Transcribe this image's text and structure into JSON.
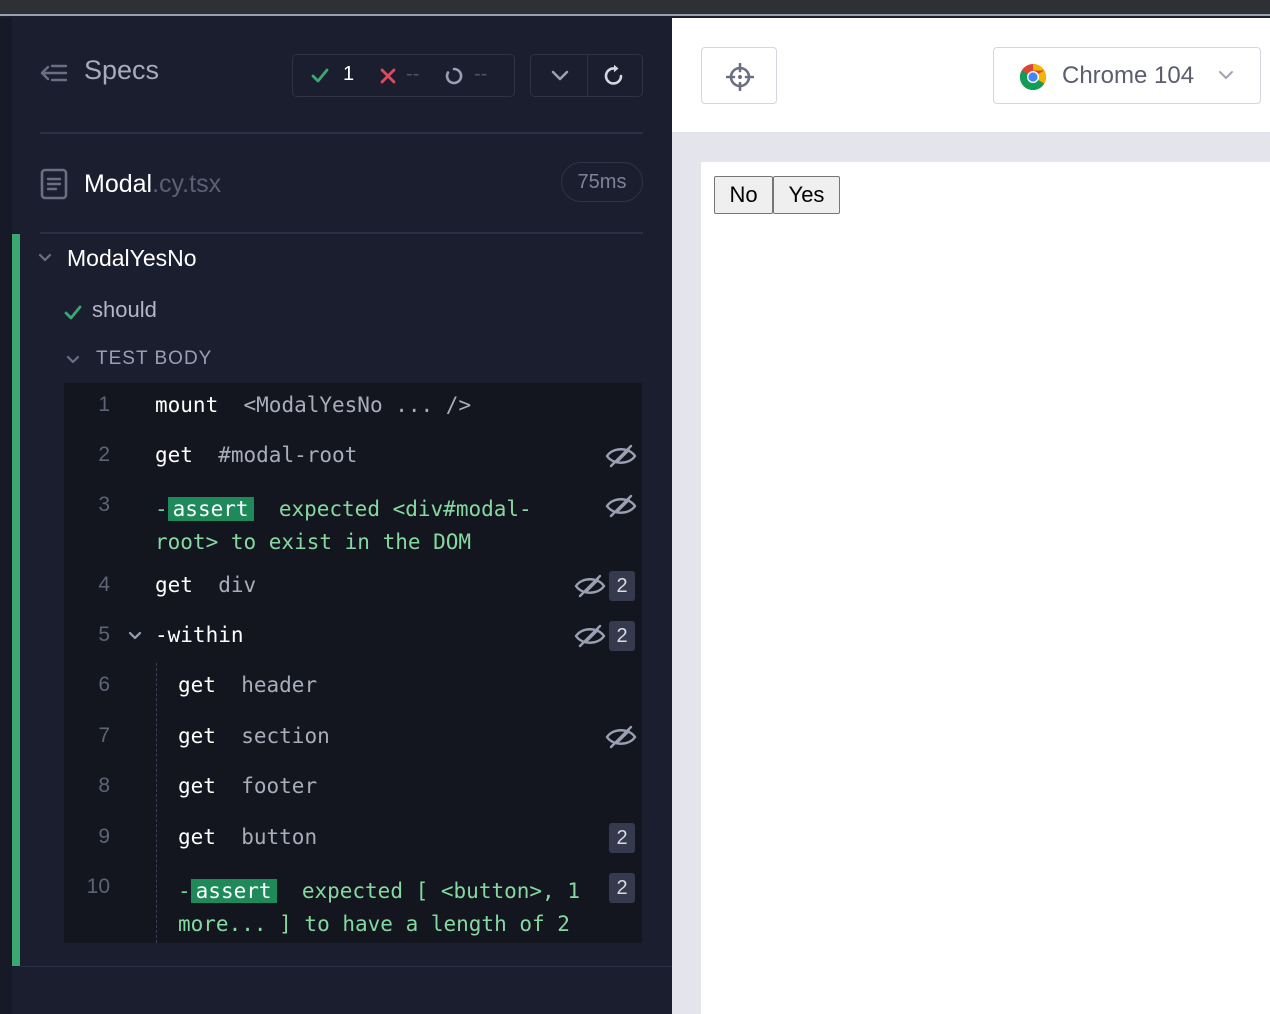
{
  "header": {
    "title": "Specs",
    "passed": "1",
    "failed": "--",
    "pending": "--"
  },
  "spec_file": {
    "name": "Modal",
    "ext": ".cy.tsx",
    "duration": "75ms"
  },
  "suite": {
    "title": "ModalYesNo"
  },
  "test": {
    "title": "should"
  },
  "test_body": {
    "label": "TEST BODY"
  },
  "commands": [
    {
      "num": "1",
      "name": "mount",
      "msg": "<ModalYesNo ... />"
    },
    {
      "num": "2",
      "name": "get",
      "msg": "#modal-root"
    },
    {
      "num": "3",
      "name": "assert",
      "dash": "-",
      "msg_line1": "expected <div#modal-",
      "msg_line2": "root> to exist in the DOM"
    },
    {
      "num": "4",
      "name": "get",
      "msg": "div",
      "count": "2"
    },
    {
      "num": "5",
      "name": "-within",
      "count": "2"
    },
    {
      "num": "6",
      "name": "get",
      "msg": "header"
    },
    {
      "num": "7",
      "name": "get",
      "msg": "section"
    },
    {
      "num": "8",
      "name": "get",
      "msg": "footer"
    },
    {
      "num": "9",
      "name": "get",
      "msg": "button",
      "count": "2"
    },
    {
      "num": "10",
      "name": "assert",
      "dash": "-",
      "msg_line1": "expected [ <button>, 1",
      "msg_line2": "more... ] to have a length of 2",
      "count": "2"
    }
  ],
  "toolbar": {
    "browser": "Chrome 104"
  },
  "app": {
    "no_label": "No",
    "yes_label": "Yes"
  },
  "colors": {
    "pass": "#3ba872",
    "fail": "#e04a5c",
    "accent_green": "#85d9a0",
    "sidebar_bg": "#1b1e2e"
  }
}
